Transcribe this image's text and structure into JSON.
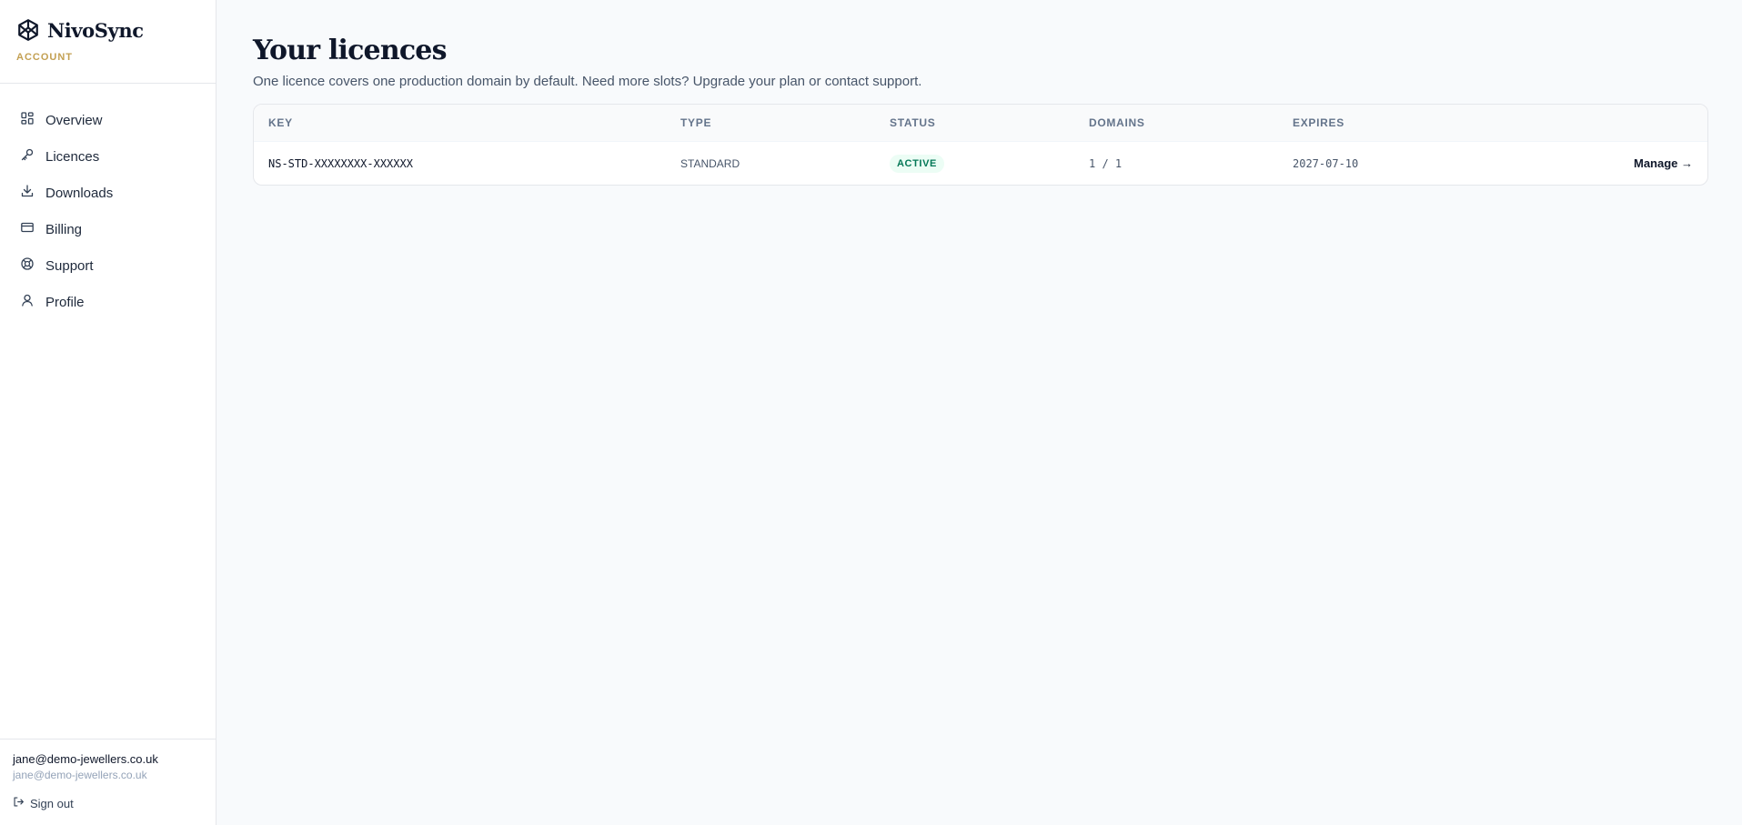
{
  "brand": {
    "name": "NivoSync",
    "subtitle": "ACCOUNT"
  },
  "nav": [
    {
      "label": "Overview",
      "icon": "grid-icon"
    },
    {
      "label": "Licences",
      "icon": "key-icon"
    },
    {
      "label": "Downloads",
      "icon": "download-icon"
    },
    {
      "label": "Billing",
      "icon": "credit-card-icon"
    },
    {
      "label": "Support",
      "icon": "lifebuoy-icon"
    },
    {
      "label": "Profile",
      "icon": "user-icon"
    }
  ],
  "user": {
    "name": "jane@demo-jewellers.co.uk",
    "email": "jane@demo-jewellers.co.uk",
    "signout_label": "Sign out"
  },
  "page": {
    "title": "Your licences",
    "description": "One licence covers one production domain by default. Need more slots? Upgrade your plan or contact support."
  },
  "table": {
    "columns": [
      "KEY",
      "TYPE",
      "STATUS",
      "DOMAINS",
      "EXPIRES"
    ],
    "rows": [
      {
        "key": "NS-STD-XXXXXXXX-XXXXXX",
        "type": "STANDARD",
        "status": "ACTIVE",
        "domains": "1 / 1",
        "expires": "2027-07-10",
        "action": "Manage →"
      }
    ]
  },
  "colors": {
    "accent_gold": "#c3a052",
    "status_active_bg": "#ecfdf5",
    "status_active_text": "#047857"
  }
}
